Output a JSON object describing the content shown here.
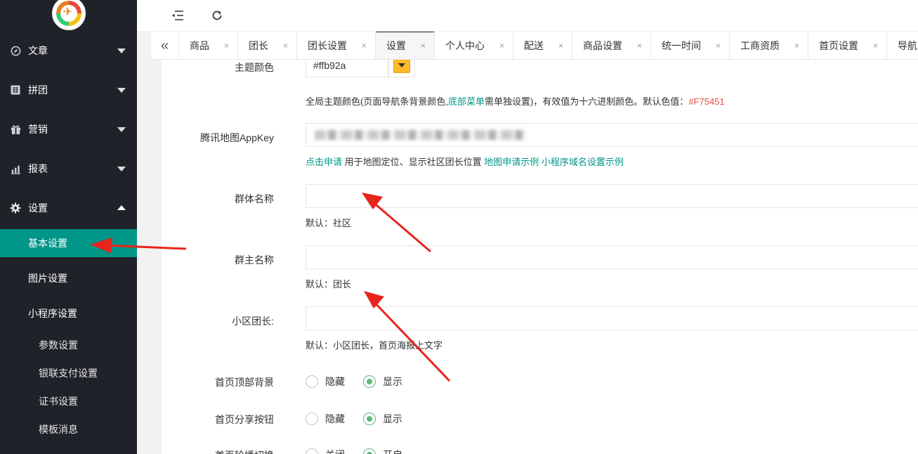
{
  "sidebar": {
    "menu": [
      {
        "label": "文章",
        "icon": "compass-icon",
        "expanded": false
      },
      {
        "label": "拼团",
        "icon": "puzzle-icon",
        "expanded": false
      },
      {
        "label": "营销",
        "icon": "gift-icon",
        "expanded": false
      },
      {
        "label": "报表",
        "icon": "chart-icon",
        "expanded": false
      },
      {
        "label": "设置",
        "icon": "gear-icon",
        "expanded": true
      }
    ],
    "settings_items": {
      "basic": "基本设置",
      "image": "图片设置",
      "miniprogram": "小程序设置"
    },
    "miniprogram_items": [
      "参数设置",
      "银联支付设置",
      "证书设置",
      "模板消息"
    ]
  },
  "tabs": [
    {
      "label": "商品",
      "active": false
    },
    {
      "label": "团长",
      "active": false
    },
    {
      "label": "团长设置",
      "active": false
    },
    {
      "label": "设置",
      "active": true
    },
    {
      "label": "个人中心",
      "active": false
    },
    {
      "label": "配送",
      "active": false
    },
    {
      "label": "商品设置",
      "active": false
    },
    {
      "label": "统一时间",
      "active": false
    },
    {
      "label": "工商资质",
      "active": false
    },
    {
      "label": "首页设置",
      "active": false
    },
    {
      "label": "导航",
      "active": false
    }
  ],
  "tab_close_glyph": "×",
  "form": {
    "theme_color": {
      "label": "主题颜色",
      "value": "#ffb92a",
      "hint_prefix": "全局主题颜色(页面导航条背景颜色,",
      "hint_link": "底部菜单",
      "hint_middle": "需单独设置)，有效值为十六进制颜色。默认色值：",
      "hint_default": "#F75451"
    },
    "map_key": {
      "label": "腾讯地图AppKey",
      "apply_link": "点击申请",
      "desc": " 用于地图定位、显示社区团长位置 ",
      "example_link": "地图申请示例",
      "domain_link": "小程序域名设置示例"
    },
    "group_name": {
      "label": "群体名称",
      "value": "",
      "hint": "默认：社区"
    },
    "owner_name": {
      "label": "群主名称",
      "value": "",
      "hint": "默认：团长"
    },
    "community_leader": {
      "label": "小区团长:",
      "value": "",
      "hint": "默认：小区团长，首页海报上文字"
    },
    "home_top_bg": {
      "label": "首页顶部背景",
      "options": [
        "隐藏",
        "显示"
      ],
      "selected": "显示"
    },
    "home_share_btn": {
      "label": "首页分享按钮",
      "options": [
        "隐藏",
        "显示"
      ],
      "selected": "显示"
    },
    "home_carousel": {
      "label": "首页轮播切换",
      "options": [
        "关闭",
        "开启"
      ],
      "selected": "开启"
    }
  },
  "colors": {
    "sidebar_bg": "#20222a",
    "active_green": "#009688",
    "radio_green": "#5FB878",
    "annotation_red": "#e8241c"
  }
}
